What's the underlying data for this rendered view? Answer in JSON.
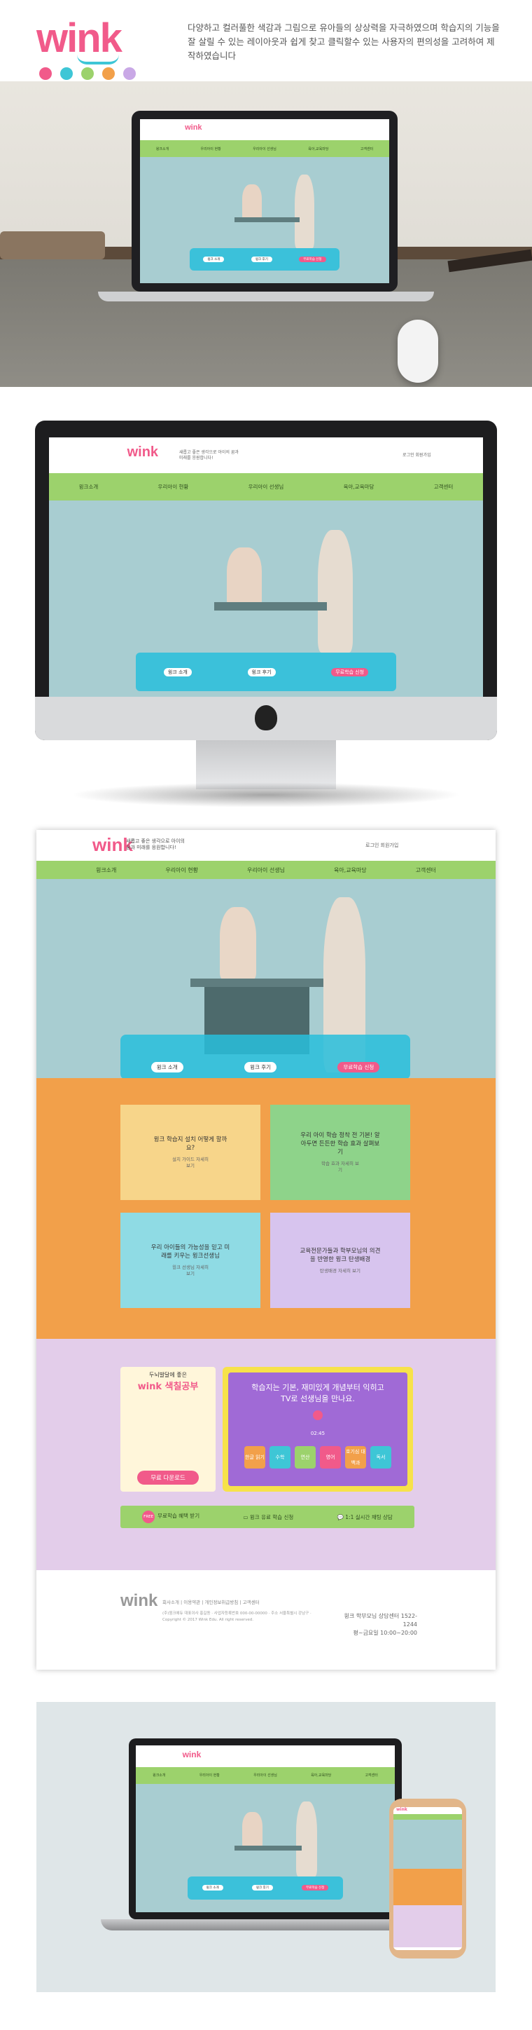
{
  "brand": {
    "name": "wink",
    "dot_colors": [
      "#f15a8a",
      "#3ec6d6",
      "#9cd26c",
      "#f2a04a",
      "#c9a8e6"
    ]
  },
  "intro": {
    "text": "다양하고 컬러풀한 색감과 그림으로 유아들의 상상력을 자극하였으며 학습지의 기능을 잘 살릴 수 있는 레이아웃과 쉽게 찾고 클릭할수 있는 사용자의 편의성을 고려하여 제작하였습니다"
  },
  "site": {
    "tagline": "새롭고 좋은 생각으로 아이의 꿈과 미래를 응원합니다!",
    "util_links": "로그인   회원가입",
    "nav": [
      "윙크소개",
      "우리아이 현황",
      "우리아이 선생님",
      "육아,교육마당",
      "고객센터"
    ],
    "hero_buttons": [
      "윙크 소개",
      "윙크 후기",
      "무료학습 신청"
    ],
    "cards": [
      {
        "title": "윙크 학습지 설치 어떻게 할까요?",
        "more": "설치 가이드 자세히 보기"
      },
      {
        "title": "우리 아이 학습 정착 전 기본! 알아두면 든든한 학습 효과 살펴보기",
        "more": "학습 효과 자세히 보기"
      },
      {
        "title": "우리 아이들의 가능성을 믿고 미래를 키우는 윙크선생님",
        "more": "윙크 선생님 자세히 보기"
      },
      {
        "title": "교육전문가들과 학부모님의 의견을 반영한 윙크 탄생배경",
        "more": "탄생배경 자세히 보기"
      }
    ],
    "book": {
      "pre": "두뇌발달에 좋은",
      "title": "wink 색칠공부",
      "button": "무료 다운로드"
    },
    "tv": {
      "line1": "학습지는 기본, 재미있게 개념부터 익히고",
      "line2": "TV로 선생님을 만나요.",
      "time": "02:45",
      "chips": [
        "한글 읽기",
        "수학",
        "연산",
        "영어",
        "호기심 대백과",
        "독서"
      ]
    },
    "strip": {
      "free_badge": "FREE",
      "item1": "무료학습 혜택 받기",
      "item2": "윙크 유료 학습 신청",
      "item3": "1:1 실시간 채팅 상담"
    },
    "footer": {
      "logo": "wink",
      "links": "회사소개  |  이용약관  |  개인정보취급방침  |  고객센터",
      "info": "(주)윙크에듀 대표이사 홍길동 · 사업자등록번호 000-00-00000 · 주소 서울특별시 강남구 · Copyright © 2017 Wink Edu. All right reserved.",
      "call_label": "윙크 학부모님 상담센터 1522-1244",
      "hours": "평~금요일 10:00~20:00"
    }
  },
  "colors": {
    "accent": "#f15a8a",
    "cyan": "#3ec6d6",
    "green": "#9cd26c",
    "orange": "#f2a04a",
    "purple": "#e3cdea",
    "tv_bg": "#a06ad6",
    "hero_bg": "#a8cdd1"
  }
}
